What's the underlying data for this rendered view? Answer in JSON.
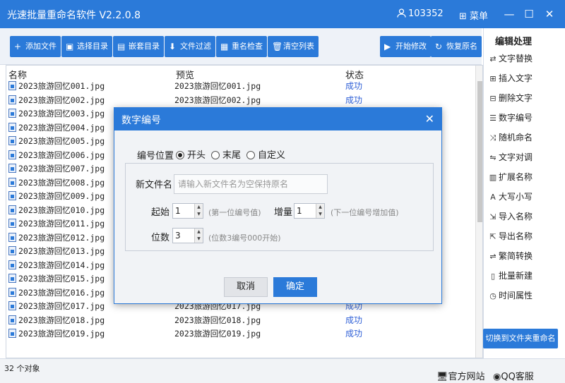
{
  "app": {
    "title": "光速批量重命名软件 V2.2.0.8",
    "user_id": "103352",
    "menu_label": "菜单",
    "minimize": "—",
    "maximize": "☐",
    "close": "✕"
  },
  "toolbar": [
    {
      "label": "添加文件",
      "icon": "+"
    },
    {
      "label": "选择目录",
      "icon": "▣"
    },
    {
      "label": "嵌套目录",
      "icon": "▤"
    },
    {
      "label": "文件过滤",
      "icon": "⬇"
    },
    {
      "label": "重名检查",
      "icon": "▦"
    },
    {
      "label": "清空列表",
      "icon": "🗑"
    },
    {
      "label": "开始修改",
      "icon": "▶"
    },
    {
      "label": "恢复原名",
      "icon": "↻"
    }
  ],
  "list": {
    "headers": {
      "name": "名称",
      "preview": "预览",
      "status": "状态"
    },
    "rows": [
      {
        "name": "2023旅游回忆001.jpg",
        "preview": "2023旅游回忆001.jpg",
        "status": "成功"
      },
      {
        "name": "2023旅游回忆002.jpg",
        "preview": "2023旅游回忆002.jpg",
        "status": "成功"
      },
      {
        "name": "2023旅游回忆003.jpg",
        "preview": "",
        "status": ""
      },
      {
        "name": "2023旅游回忆004.jpg",
        "preview": "",
        "status": ""
      },
      {
        "name": "2023旅游回忆005.jpg",
        "preview": "",
        "status": ""
      },
      {
        "name": "2023旅游回忆006.jpg",
        "preview": "",
        "status": ""
      },
      {
        "name": "2023旅游回忆007.jpg",
        "preview": "",
        "status": ""
      },
      {
        "name": "2023旅游回忆008.jpg",
        "preview": "",
        "status": ""
      },
      {
        "name": "2023旅游回忆009.jpg",
        "preview": "",
        "status": ""
      },
      {
        "name": "2023旅游回忆010.jpg",
        "preview": "",
        "status": ""
      },
      {
        "name": "2023旅游回忆011.jpg",
        "preview": "",
        "status": ""
      },
      {
        "name": "2023旅游回忆012.jpg",
        "preview": "",
        "status": ""
      },
      {
        "name": "2023旅游回忆013.jpg",
        "preview": "",
        "status": ""
      },
      {
        "name": "2023旅游回忆014.jpg",
        "preview": "",
        "status": ""
      },
      {
        "name": "2023旅游回忆015.jpg",
        "preview": "",
        "status": ""
      },
      {
        "name": "2023旅游回忆016.jpg",
        "preview": "",
        "status": ""
      },
      {
        "name": "2023旅游回忆017.jpg",
        "preview": "2023旅游回忆017.jpg",
        "status": "成功"
      },
      {
        "name": "2023旅游回忆018.jpg",
        "preview": "2023旅游回忆018.jpg",
        "status": "成功"
      },
      {
        "name": "2023旅游回忆019.jpg",
        "preview": "2023旅游回忆019.jpg",
        "status": "成功"
      }
    ]
  },
  "sidebar": {
    "title": "编辑处理",
    "items": [
      {
        "label": "文字替换",
        "icon": "⇄"
      },
      {
        "label": "插入文字",
        "icon": "⊞"
      },
      {
        "label": "删除文字",
        "icon": "⊟"
      },
      {
        "label": "数字编号",
        "icon": "☰"
      },
      {
        "label": "随机命名",
        "icon": "⤨"
      },
      {
        "label": "文字对调",
        "icon": "⇋"
      },
      {
        "label": "扩展名称",
        "icon": "▥"
      },
      {
        "label": "大写小写",
        "icon": "A"
      },
      {
        "label": "导入名称",
        "icon": "⇲"
      },
      {
        "label": "导出名称",
        "icon": "⇱"
      },
      {
        "label": "繁简转换",
        "icon": "⇌"
      },
      {
        "label": "批量新建",
        "icon": "▯"
      },
      {
        "label": "时间属性",
        "icon": "◷"
      }
    ],
    "switch_button": "切换到文件夹重命名"
  },
  "status": {
    "count": "32 个对象",
    "website": "官方网站",
    "qq": "QQ客服"
  },
  "dialog": {
    "title": "数字编号",
    "close": "✕",
    "position_label": "编号位置",
    "positions": [
      "开头",
      "末尾",
      "自定义"
    ],
    "selected_position": "开头",
    "new_name_label": "新文件名",
    "new_name_placeholder": "请输入新文件名为空保持原名",
    "start_label": "起始",
    "start_value": "1",
    "start_hint": "(第一位编号值)",
    "step_label": "增量",
    "step_value": "1",
    "step_hint": "(下一位编号增加值)",
    "digits_label": "位数",
    "digits_value": "3",
    "digits_hint": "(位数3编号000开始)",
    "cancel": "取消",
    "confirm": "确定"
  }
}
